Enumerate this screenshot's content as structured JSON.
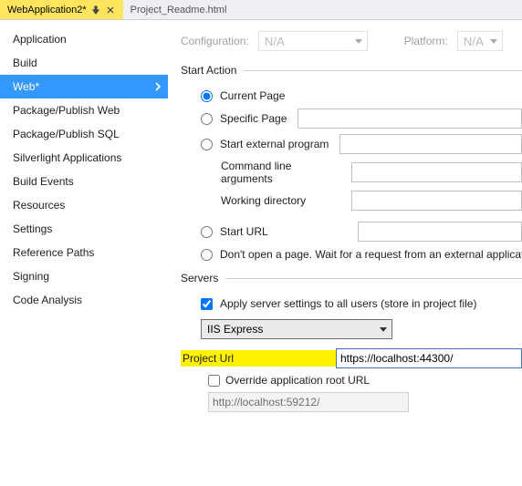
{
  "tabs": [
    {
      "label": "WebApplication2*",
      "active": true
    },
    {
      "label": "Project_Readme.html",
      "active": false
    }
  ],
  "sidebar": {
    "items": [
      "Application",
      "Build",
      "Web*",
      "Package/Publish Web",
      "Package/Publish SQL",
      "Silverlight Applications",
      "Build Events",
      "Resources",
      "Settings",
      "Reference Paths",
      "Signing",
      "Code Analysis"
    ],
    "selected_index": 2
  },
  "config": {
    "configuration_label": "Configuration:",
    "configuration_value": "N/A",
    "platform_label": "Platform:",
    "platform_value": "N/A"
  },
  "sections": {
    "start_action": "Start Action",
    "servers": "Servers"
  },
  "start_action": {
    "current_page": "Current Page",
    "specific_page": "Specific Page",
    "start_external": "Start external program",
    "cmd_args": "Command line arguments",
    "working_dir": "Working directory",
    "start_url": "Start URL",
    "dont_open": "Don't open a page.  Wait for a request from an external application."
  },
  "servers": {
    "apply_all": "Apply server settings to all users (store in project file)",
    "server_select": "IIS Express",
    "project_url_label": "Project Url",
    "project_url_value": "https://localhost:44300/",
    "override_label": "Override application root URL",
    "root_url_value": "http://localhost:59212/"
  }
}
